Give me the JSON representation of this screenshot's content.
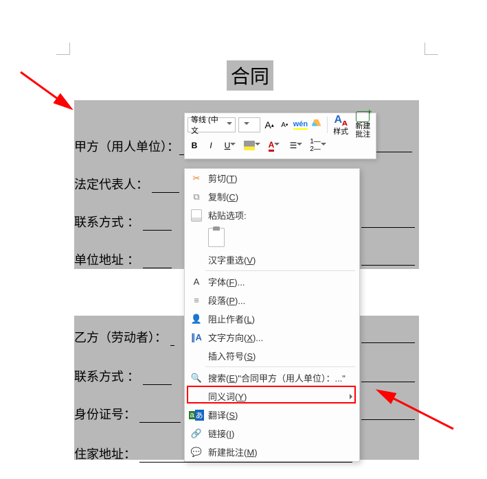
{
  "doc": {
    "title": "合同",
    "fields": {
      "party_a": "甲方（用人单位）：",
      "legal_rep": "法定代表人：",
      "contact1": "联系方式 ：",
      "address1": "单位地址 ：",
      "party_b": "乙方（劳动者）：",
      "contact2": "联系方式 ：",
      "id_no": "身份证号：",
      "address2": "住家地址："
    }
  },
  "mini_toolbar": {
    "font_name": "等线 (中文",
    "font_size": "",
    "grow_label": "A",
    "shrink_label": "A",
    "wen_label": "wén",
    "styles_caption": "样式",
    "new_comment_caption": "新建\n批注",
    "bold": "B",
    "italic": "I",
    "underline": "U",
    "font_color": "A"
  },
  "context_menu": {
    "cut": {
      "label": "剪切(",
      "hotkey": "T",
      "suffix": ")"
    },
    "copy": {
      "label": "复制(",
      "hotkey": "C",
      "suffix": ")"
    },
    "paste_options": {
      "label": "粘贴选项:"
    },
    "reconvert": {
      "label": "汉字重选(",
      "hotkey": "V",
      "suffix": ")"
    },
    "font": {
      "label": "字体(",
      "hotkey": "F",
      "suffix": ")...",
      "icon": "A"
    },
    "paragraph": {
      "label": "段落(",
      "hotkey": "P",
      "suffix": ")..."
    },
    "block_authors": {
      "label": "阻止作者(",
      "hotkey": "L",
      "suffix": ")"
    },
    "text_direction": {
      "label": "文字方向(",
      "hotkey": "X",
      "suffix": ")..."
    },
    "insert_symbol": {
      "label": "插入符号(",
      "hotkey": "S",
      "suffix": ")"
    },
    "search": {
      "label": "搜索(",
      "hotkey": "E",
      "suffix": ")\"合同甲方（用人单位）：...\""
    },
    "synonyms": {
      "label": "同义词(",
      "hotkey": "Y",
      "suffix": ")"
    },
    "translate": {
      "label": "翻译(",
      "hotkey": "S",
      "suffix": ")"
    },
    "link": {
      "label": "链接(",
      "hotkey": "I",
      "suffix": ")"
    },
    "new_comment": {
      "label": "新建批注(",
      "hotkey": "M",
      "suffix": ")"
    }
  }
}
